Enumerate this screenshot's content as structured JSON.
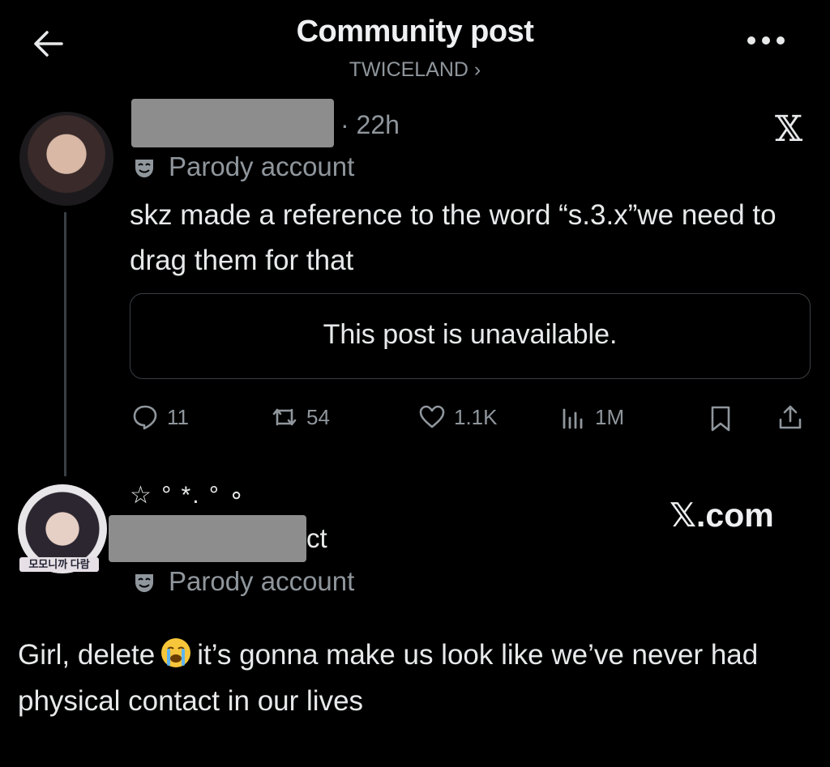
{
  "header": {
    "title": "Community post",
    "community": "TWICELAND ›"
  },
  "post": {
    "time": "· 22h",
    "label": "Parody account",
    "text": "skz made a reference to the word “s.3.x”we need to drag them for that",
    "unavailable": "This post is unavailable.",
    "stats": {
      "replies": "11",
      "reposts": "54",
      "likes": "1.1K",
      "views": "1M"
    }
  },
  "reply": {
    "name_decoration": "☆ ° *. ° ∘",
    "name_fragment": "ct",
    "label": "Parody account",
    "avatar_tag": "모모니까 다람",
    "text_before_emoji": "Girl, delete",
    "text_after_emoji": "it’s gonna make us look like we’ve never had physical contact in our lives"
  },
  "watermark": "𝕏.com",
  "brand_logo": "𝕏",
  "icons": {
    "back": "arrow-left-icon",
    "more": "more-dots-icon",
    "parody": "theater-mask-icon",
    "reply": "speech-bubble-icon",
    "repost": "repost-icon",
    "like": "heart-icon",
    "views": "bar-chart-icon",
    "bookmark": "bookmark-icon",
    "share": "share-icon",
    "emoji": "loudly-crying-face-icon"
  },
  "colors": {
    "background": "#000000",
    "text": "#e7e9ea",
    "muted": "#8f969c",
    "border": "#3a3f44"
  }
}
